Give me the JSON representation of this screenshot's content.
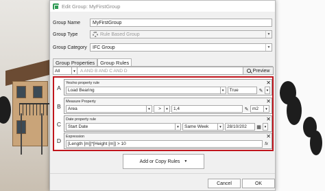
{
  "window": {
    "title": "Edit Group: MyFirstGroup"
  },
  "form": {
    "group_name_label": "Group Name",
    "group_name_value": "MyFirstGroup",
    "group_type_label": "Group Type",
    "group_type_value": "Rule Based Group",
    "group_category_label": "Group Category",
    "group_category_value": "IFC Group"
  },
  "tabs": [
    {
      "label": "Group Properties"
    },
    {
      "label": "Group Rules"
    }
  ],
  "filter": {
    "selection": "All",
    "expression": "A AND B AND C AND D",
    "preview_label": "Preview"
  },
  "rules": [
    {
      "letter": "A",
      "title": "Yes/no property rule",
      "property": "Load Bearing",
      "value": "True"
    },
    {
      "letter": "B",
      "title": "Measure Property",
      "property": "Area",
      "operator": ">",
      "value": "1,4",
      "unit": "m2"
    },
    {
      "letter": "C",
      "title": "Date property rule",
      "property": "Start Date",
      "period": "Same Week",
      "date": "28/10/202"
    },
    {
      "letter": "D",
      "title": "Expression",
      "expression": "[Length [m]]*[Height [m]] > 10",
      "suffix": "fx"
    }
  ],
  "actions": {
    "add_copy_label": "Add or Copy Rules",
    "cancel_label": "Cancel",
    "ok_label": "OK"
  },
  "colors": {
    "highlight": "#c0151c",
    "app_icon": "#2e9a53"
  }
}
